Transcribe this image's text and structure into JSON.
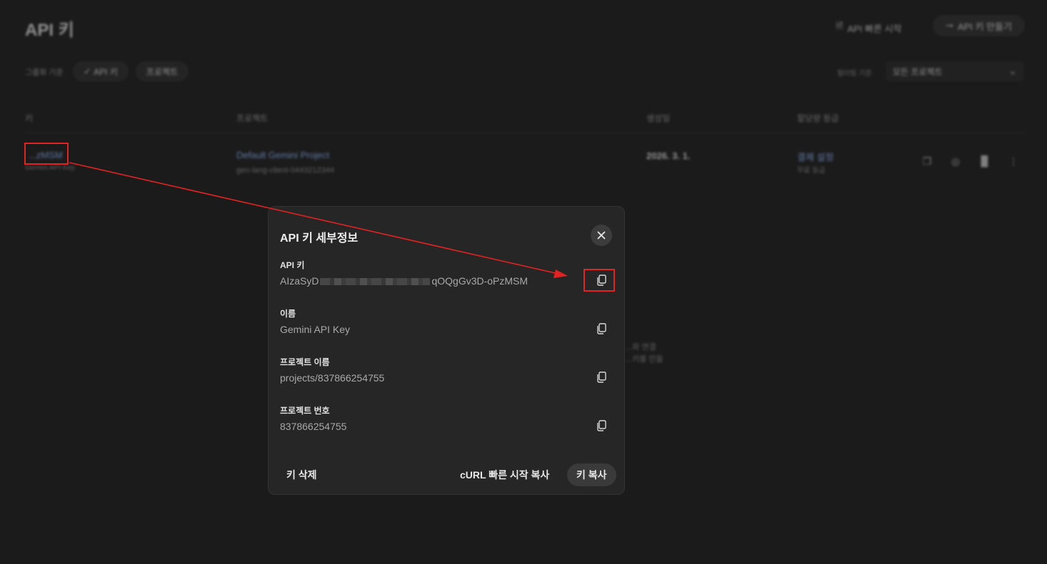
{
  "background": {
    "page_title": "API 키",
    "quickstart_label": "API 빠른 시작",
    "create_key_label": "API 키 만들기",
    "group_by_label": "그룹화 기준",
    "group_chips": [
      "API 키",
      "프로젝트"
    ],
    "filter_label": "필터링 기준",
    "filter_value": "모든 프로젝트",
    "columns": [
      "키",
      "프로젝트",
      "생성일",
      "할당량 등급"
    ],
    "row": {
      "key": "...zMSM",
      "key_name": "Gemini API Key",
      "project": "Default Gemini Project",
      "project_id": "gen-lang-client-0443212344",
      "created": "2026. 3. 1.",
      "tier": "결제 설정",
      "tier_sub": "무료 등급"
    },
    "empty_text": [
      "...와 연결",
      "...키를 만들"
    ]
  },
  "dialog": {
    "title": "API 키 세부정보",
    "fields": [
      {
        "label": "API 키",
        "value_prefix": "AIzaSyD",
        "value_suffix": "qOQgGv3D-oPzMSM"
      },
      {
        "label": "이름",
        "value": "Gemini API Key"
      },
      {
        "label": "프로젝트 이름",
        "value": "projects/837866254755"
      },
      {
        "label": "프로젝트 번호",
        "value": "837866254755"
      }
    ],
    "actions": {
      "delete": "키 삭제",
      "curl": "cURL 빠른 시작 복사",
      "copy": "키 복사"
    }
  },
  "icons": {
    "close": "close-icon",
    "copy": "copy-icon"
  },
  "colors": {
    "annotation": "#e32222",
    "link": "#8ab4f8"
  }
}
